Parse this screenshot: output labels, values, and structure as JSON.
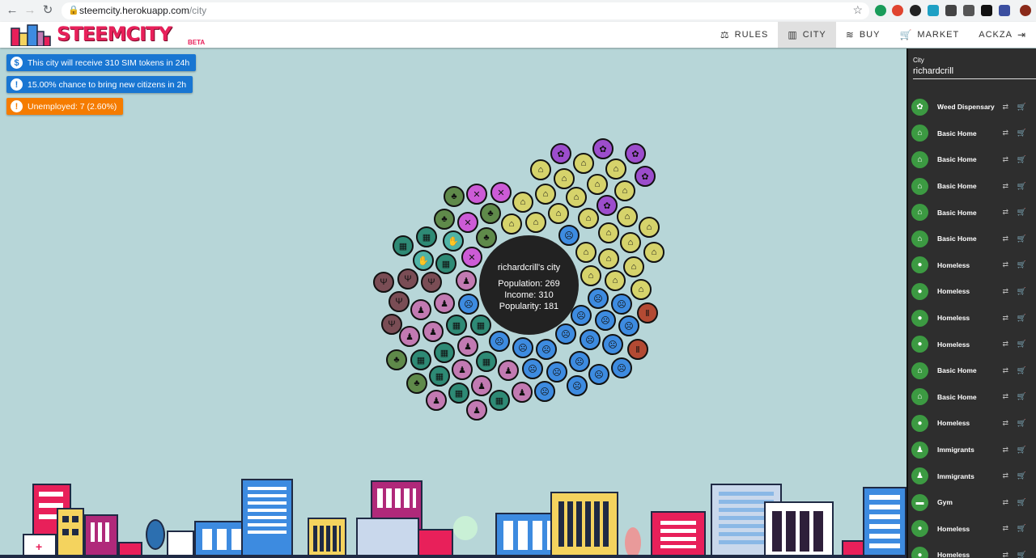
{
  "browser": {
    "url_host": "steemcity.herokuapp.com",
    "url_path": "/city"
  },
  "app": {
    "logo": "STEEMCITY",
    "logo_badge": "BETA",
    "menu": [
      {
        "label": "RULES",
        "icon": "balance-scale-icon",
        "glyph": "⚖"
      },
      {
        "label": "CITY",
        "icon": "city-icon",
        "glyph": "▥"
      },
      {
        "label": "BUY",
        "icon": "layers-icon",
        "glyph": "≋"
      },
      {
        "label": "MARKET",
        "icon": "cart-icon",
        "glyph": "🛒"
      },
      {
        "label": "ACKZA",
        "icon": "sign-out-icon",
        "glyph": "⇥"
      }
    ]
  },
  "notices": [
    {
      "text": "This city will receive 310 SIM tokens in 24h",
      "icon": "dollar-icon",
      "glyph": "$",
      "color": "#1976d2"
    },
    {
      "text": "15.00% chance to bring new citizens in 2h",
      "icon": "exclamation-icon",
      "glyph": "!",
      "color": "#1976d2"
    },
    {
      "text": "Unemployed: 7 (2.60%)",
      "icon": "exclamation-icon",
      "glyph": "!",
      "color": "#f57c00"
    }
  ],
  "city_center": {
    "title": "richardcrill's city",
    "population": "Population: 269",
    "income": "Income: 310",
    "popularity": "Popularity: 181"
  },
  "colors": {
    "house": "#d6d36b",
    "weed": "#9c4dcc",
    "homeless": "#3d8be0",
    "immigrant": "#c27ab2",
    "office": "#2e8a75",
    "restaurant": "#7a4d55",
    "farm": "#5f8a4a",
    "shop": "#cc5bd6",
    "gym": "#b34a33",
    "worker": "#4fb3a6",
    "sidebar_icon": "#3c9a42"
  },
  "sidebar": {
    "city_label": "City",
    "city_value": "richardcrill",
    "items": [
      {
        "name": "Weed Dispensary",
        "icon": "weed-icon",
        "glyph": "✿"
      },
      {
        "name": "Basic Home",
        "icon": "home-icon",
        "glyph": "⌂"
      },
      {
        "name": "Basic Home",
        "icon": "home-icon",
        "glyph": "⌂"
      },
      {
        "name": "Basic Home",
        "icon": "home-icon",
        "glyph": "⌂"
      },
      {
        "name": "Basic Home",
        "icon": "home-icon",
        "glyph": "⌂"
      },
      {
        "name": "Basic Home",
        "icon": "home-icon",
        "glyph": "⌂"
      },
      {
        "name": "Homeless",
        "icon": "homeless-icon",
        "glyph": "●"
      },
      {
        "name": "Homeless",
        "icon": "homeless-icon",
        "glyph": "●"
      },
      {
        "name": "Homeless",
        "icon": "homeless-icon",
        "glyph": "●"
      },
      {
        "name": "Homeless",
        "icon": "homeless-icon",
        "glyph": "●"
      },
      {
        "name": "Basic Home",
        "icon": "home-icon",
        "glyph": "⌂"
      },
      {
        "name": "Basic Home",
        "icon": "home-icon",
        "glyph": "⌂"
      },
      {
        "name": "Homeless",
        "icon": "homeless-icon",
        "glyph": "●"
      },
      {
        "name": "Immigrants",
        "icon": "immigrant-icon",
        "glyph": "♟"
      },
      {
        "name": "Immigrants",
        "icon": "immigrant-icon",
        "glyph": "♟"
      },
      {
        "name": "Gym",
        "icon": "dumbbell-icon",
        "glyph": "▬"
      },
      {
        "name": "Homeless",
        "icon": "homeless-icon",
        "glyph": "●"
      },
      {
        "name": "Homeless",
        "icon": "homeless-icon",
        "glyph": "●"
      }
    ]
  }
}
